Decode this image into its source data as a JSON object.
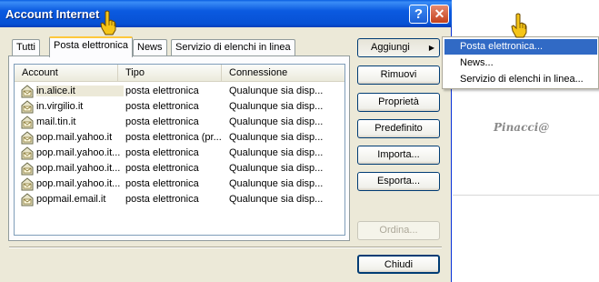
{
  "window": {
    "title": "Account Internet",
    "help_icon": "question-mark",
    "close_icon": "x"
  },
  "tabs": [
    {
      "label": "Tutti",
      "active": false
    },
    {
      "label": "Posta elettronica",
      "active": true
    },
    {
      "label": "News",
      "active": false
    },
    {
      "label": "Servizio di elenchi in linea",
      "active": false
    }
  ],
  "list": {
    "columns": [
      "Account",
      "Tipo",
      "Connessione"
    ],
    "rows": [
      {
        "account": "in.alice.it",
        "tipo": "posta elettronica",
        "connessione": "Qualunque sia disp..."
      },
      {
        "account": "in.virgilio.it",
        "tipo": "posta elettronica",
        "connessione": "Qualunque sia disp..."
      },
      {
        "account": "mail.tin.it",
        "tipo": "posta elettronica",
        "connessione": "Qualunque sia disp..."
      },
      {
        "account": "pop.mail.yahoo.it",
        "tipo": "posta elettronica (pr...",
        "connessione": "Qualunque sia disp..."
      },
      {
        "account": "pop.mail.yahoo.it...",
        "tipo": "posta elettronica",
        "connessione": "Qualunque sia disp..."
      },
      {
        "account": "pop.mail.yahoo.it...",
        "tipo": "posta elettronica",
        "connessione": "Qualunque sia disp..."
      },
      {
        "account": "pop.mail.yahoo.it...",
        "tipo": "posta elettronica",
        "connessione": "Qualunque sia disp..."
      },
      {
        "account": "popmail.email.it",
        "tipo": "posta elettronica",
        "connessione": "Qualunque sia disp..."
      }
    ],
    "selected_row": 0,
    "row_icon": "mail-account-icon"
  },
  "buttons": {
    "aggiungi": "Aggiungi",
    "aggiungi_arrow": "▶",
    "rimuovi": "Rimuovi",
    "proprieta": "Proprietà",
    "predefinito": "Predefinito",
    "importa": "Importa...",
    "esporta": "Esporta...",
    "ordina": "Ordina...",
    "chiudi": "Chiudi"
  },
  "menu": {
    "items": [
      {
        "label": "Posta elettronica...",
        "highlighted": true
      },
      {
        "label": "News...",
        "highlighted": false
      },
      {
        "label": "Servizio di elenchi in linea...",
        "highlighted": false
      }
    ]
  },
  "watermark": "Pinacci@",
  "colors": {
    "titlebar": "#0a5ee0",
    "dialog_bg": "#ece9d8",
    "menu_highlight": "#316ac5",
    "active_tab_accent": "#ffc83c",
    "cursor": "#f5c518"
  }
}
